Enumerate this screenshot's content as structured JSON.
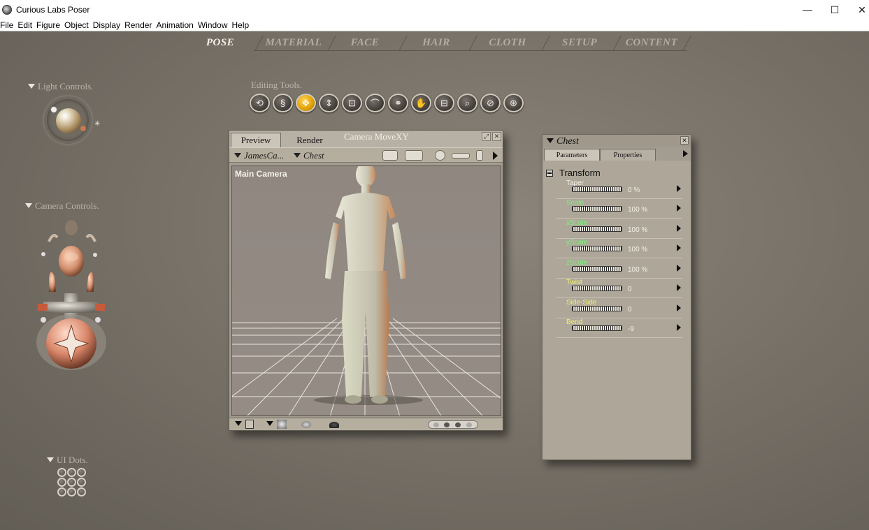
{
  "window": {
    "title": "Curious Labs Poser",
    "minimize": "—",
    "maximize": "☐",
    "close": "✕"
  },
  "menu": [
    "File",
    "Edit",
    "Figure",
    "Object",
    "Display",
    "Render",
    "Animation",
    "Window",
    "Help"
  ],
  "rooms": [
    "POSE",
    "MATERIAL",
    "FACE",
    "HAIR",
    "CLOTH",
    "SETUP",
    "CONTENT"
  ],
  "active_room": "POSE",
  "light_controls": {
    "label": "Light Controls."
  },
  "camera_controls": {
    "label": "Camera Controls."
  },
  "ui_dots": {
    "label": "UI Dots."
  },
  "editing_tools": {
    "label": "Editing Tools.",
    "tools": [
      {
        "icon": "rotate-icon",
        "glyph": "⟲"
      },
      {
        "icon": "twist-icon",
        "glyph": "§"
      },
      {
        "icon": "translate-xy-icon",
        "glyph": "✥"
      },
      {
        "icon": "translate-z-icon",
        "glyph": "⇕"
      },
      {
        "icon": "scale-icon",
        "glyph": "⊡"
      },
      {
        "icon": "taper-icon",
        "glyph": "⌒"
      },
      {
        "icon": "chain-break-icon",
        "glyph": "⚭"
      },
      {
        "icon": "color-icon",
        "glyph": "✋"
      },
      {
        "icon": "grouping-icon",
        "glyph": "⊟"
      },
      {
        "icon": "view-magnifier-icon",
        "glyph": "⌕"
      },
      {
        "icon": "morphing-icon",
        "glyph": "⊘"
      },
      {
        "icon": "direct-manipulation-icon",
        "glyph": "⊛"
      }
    ],
    "active_index": 2
  },
  "preview": {
    "tabs": [
      "Preview",
      "Render"
    ],
    "active_tab": "Preview",
    "title": "Camera MoveXY",
    "figure_select": "JamesCa...",
    "actor_select": "Chest",
    "viewport_label": "Main Camera"
  },
  "params": {
    "title": "Chest",
    "tabs": [
      "Parameters",
      "Properties"
    ],
    "active_tab": "Parameters",
    "group": "Transform",
    "items": [
      {
        "name": "Taper",
        "value": "0 %",
        "color": "#f0ede4"
      },
      {
        "name": "Scale",
        "value": "100 %",
        "color": "#7cf07c"
      },
      {
        "name": "xScale",
        "value": "100 %",
        "color": "#7cf07c"
      },
      {
        "name": "yScale",
        "value": "100 %",
        "color": "#7cf07c"
      },
      {
        "name": "zScale",
        "value": "100 %",
        "color": "#7cf07c"
      },
      {
        "name": "Twist",
        "value": "0",
        "color": "#f2f06a"
      },
      {
        "name": "Side-Side",
        "value": "0",
        "color": "#f2f06a"
      },
      {
        "name": "Bend",
        "value": "-9",
        "color": "#f2f06a"
      }
    ]
  }
}
